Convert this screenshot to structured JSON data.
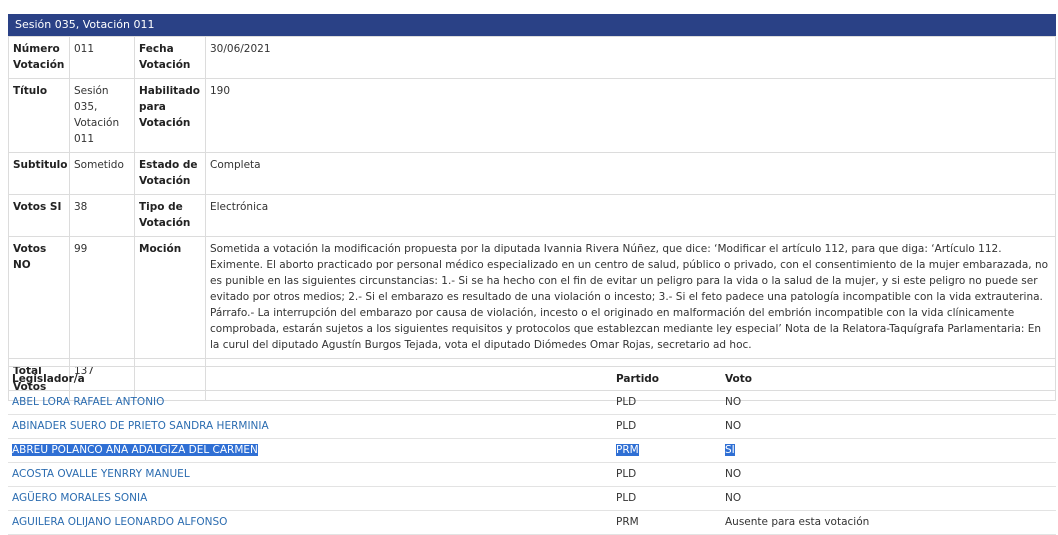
{
  "header": {
    "title": "Sesión 035, Votación 011"
  },
  "info": {
    "numero_label": "Número Votación",
    "numero": "011",
    "fecha_label": "Fecha Votación",
    "fecha": "30/06/2021",
    "titulo_label": "Título",
    "titulo": "Sesión 035, Votación 011",
    "habilitado_label": "Habilitado para Votación",
    "habilitado": "190",
    "subtitulo_label": "Subtitulo",
    "subtitulo": "Sometido",
    "estado_label": "Estado de Votación",
    "estado": "Completa",
    "votos_si_label": "Votos SI",
    "votos_si": "38",
    "tipo_label": "Tipo de Votación",
    "tipo": "Electrónica",
    "votos_no_label": "Votos NO",
    "votos_no": "99",
    "mocion_label": "Moción",
    "mocion": "Sometida a votación la modificación propuesta por la diputada Ivannia Rivera Núñez, que dice: ‘Modificar el artículo 112, para que diga: ‘Artículo 112. Eximente. El aborto practicado por personal médico especializado en un centro de salud, público o privado, con el consentimiento de la mujer embarazada, no es punible en las siguientes circunstancias: 1.- Si se ha hecho con el fin de evitar un peligro para la vida o la salud de la mujer, y si este peligro no puede ser evitado por otros medios; 2.- Si el embarazo es resultado de una violación o incesto; 3.- Si el feto padece una patología incompatible con la vida extrauterina. Párrafo.- La interrupción del embarazo por causa de violación, incesto o el originado en malformación del embrión incompatible con la vida clínicamente comprobada, estarán sujetos a los siguientes requisitos y protocolos que establezcan mediante ley especial’ Nota de la Relatora-Taquígrafa Parlamentaria: En la curul del diputado Agustín Burgos Tejada, vota el diputado Diómedes Omar Rojas, secretario ad hoc.",
    "total_label": "Total Votos",
    "total": "137"
  },
  "votes": {
    "col_legislador": "Legislador/a",
    "col_partido": "Partido",
    "col_voto": "Voto",
    "rows": [
      {
        "name": "ABEL LORA RAFAEL ANTONIO",
        "party": "PLD",
        "vote": "NO"
      },
      {
        "name": "ABINADER SUERO DE PRIETO SANDRA HERMINIA",
        "party": "PLD",
        "vote": "NO"
      },
      {
        "name": "ABREU POLANCO ANA ADALGIZA DEL CARMEN",
        "party": "PRM",
        "vote": "SI",
        "selected": true
      },
      {
        "name": "ACOSTA OVALLE YENRRY MANUEL",
        "party": "PLD",
        "vote": "NO"
      },
      {
        "name": "AGÜERO MORALES SONIA",
        "party": "PLD",
        "vote": "NO"
      },
      {
        "name": "AGUILERA OLIJANO LEONARDO ALFONSO",
        "party": "PRM",
        "vote": "Ausente para esta votación"
      }
    ]
  }
}
